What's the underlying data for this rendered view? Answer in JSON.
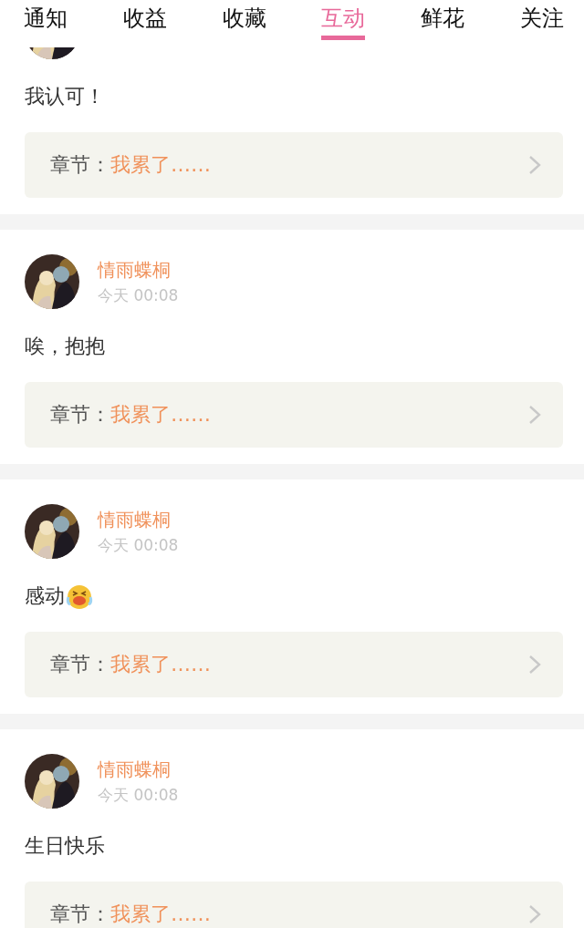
{
  "tabs": [
    {
      "label": "通知",
      "selected": false
    },
    {
      "label": "收益",
      "selected": false
    },
    {
      "label": "收藏",
      "selected": false
    },
    {
      "label": "互动",
      "selected": true
    },
    {
      "label": "鲜花",
      "selected": false
    },
    {
      "label": "关注",
      "selected": false
    }
  ],
  "comments": [
    {
      "kind": "text",
      "comment": "我认可！",
      "chapter_label": "章节：",
      "chapter_title": "我累了……"
    },
    {
      "kind": "text",
      "user": "情雨蝶桐",
      "time": "今天 00:08",
      "comment": "唉，抱抱",
      "chapter_label": "章节：",
      "chapter_title": "我累了……"
    },
    {
      "kind": "emoji",
      "user": "情雨蝶桐",
      "time": "今天 00:08",
      "comment": "感动",
      "chapter_label": "章节：",
      "chapter_title": "我累了……"
    },
    {
      "kind": "text",
      "user": "情雨蝶桐",
      "time": "今天 00:08",
      "comment": "生日快乐",
      "chapter_label": "章节：",
      "chapter_title": "我累了……"
    }
  ]
}
